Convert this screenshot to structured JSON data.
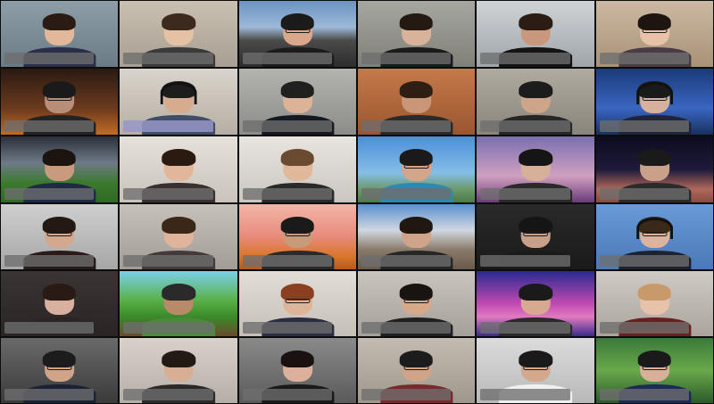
{
  "app": {
    "view": "gallery",
    "columns": 6,
    "rows": 6
  },
  "tiles": [
    {
      "row": 0,
      "col": 0,
      "bg": "linear-gradient(#8d9ea8,#6a7b85)",
      "skin": "#e2b79a",
      "hair": "#2a1c14",
      "shirt": "#2b2f4a",
      "glasses": false,
      "headset": false
    },
    {
      "row": 0,
      "col": 1,
      "bg": "linear-gradient(#c9c0b2,#a89f92)",
      "skin": "#e6c2a4",
      "hair": "#3b2a1d",
      "shirt": "#3a3a3a",
      "glasses": false,
      "headset": false
    },
    {
      "row": 0,
      "col": 2,
      "bg": "linear-gradient(#6b93c4 0%,#9db9d6 40%,#4a4a4a 60%,#2d2d2d 100%)",
      "skin": "#d9a88a",
      "hair": "#1b1b1b",
      "shirt": "#1c1c1c",
      "glasses": true,
      "headset": false
    },
    {
      "row": 0,
      "col": 3,
      "bg": "linear-gradient(#a7a7a2,#808078)",
      "skin": "#d8b39a",
      "hair": "#241a12",
      "shirt": "#1a1a1a",
      "glasses": false,
      "headset": false
    },
    {
      "row": 0,
      "col": 4,
      "bg": "linear-gradient(#cfd3d6,#9fa5aa)",
      "skin": "#c9987c",
      "hair": "#2b1d14",
      "shirt": "#141414",
      "glasses": false,
      "headset": false
    },
    {
      "row": 0,
      "col": 5,
      "bg": "linear-gradient(#cdb9a3,#a89278)",
      "skin": "#e8c2a8",
      "hair": "#1e1410",
      "shirt": "#4a3c44",
      "glasses": true,
      "headset": false
    },
    {
      "row": 1,
      "col": 0,
      "bg": "linear-gradient(#2a1a12,#6b3a1e 60%,#c56b22)",
      "skin": "#b98e78",
      "hair": "#1a1a1a",
      "shirt": "#232323",
      "glasses": true,
      "headset": false
    },
    {
      "row": 1,
      "col": 1,
      "bg": "linear-gradient(#d9d4cc,#b6aea2)",
      "skin": "#d6ab8e",
      "hair": "#1d1d1d",
      "shirt": "#3f4d66",
      "glasses": false,
      "headset": true,
      "highlight": true
    },
    {
      "row": 1,
      "col": 2,
      "bg": "linear-gradient(#b3b3b0,#8c8c88)",
      "skin": "#dcb396",
      "hair": "#202020",
      "shirt": "#151a22",
      "glasses": false,
      "headset": false
    },
    {
      "row": 1,
      "col": 3,
      "bg": "linear-gradient(#c67a4a,#9a5530)",
      "skin": "#c99678",
      "hair": "#2e1e14",
      "shirt": "#2a2a2a",
      "glasses": false,
      "headset": false
    },
    {
      "row": 1,
      "col": 4,
      "bg": "linear-gradient(#b0aaa0,#8a857c)",
      "skin": "#cfa58a",
      "hair": "#1c1c1c",
      "shirt": "#262626",
      "glasses": false,
      "headset": false
    },
    {
      "row": 1,
      "col": 5,
      "bg": "linear-gradient(#1b3a7a,#3a66c0 60%,#183060)",
      "skin": "#d8b0a0",
      "hair": "#1a1a1a",
      "shirt": "#20243a",
      "glasses": true,
      "headset": true
    },
    {
      "row": 2,
      "col": 0,
      "bg": "linear-gradient(#2b2f3a 0%,#6e7a88 40%,#3c7a2e 70%,#2f6a24 100%)",
      "skin": "#c99a7e",
      "hair": "#1c140f",
      "shirt": "#1f2a44",
      "glasses": false,
      "headset": false
    },
    {
      "row": 2,
      "col": 1,
      "bg": "linear-gradient(#e6e1da,#c9c3bb)",
      "skin": "#e2b69a",
      "hair": "#2a1a10",
      "shirt": "#3a3030",
      "glasses": false,
      "headset": false
    },
    {
      "row": 2,
      "col": 2,
      "bg": "linear-gradient(#e8e4df,#cbc6c0)",
      "skin": "#e0b89c",
      "hair": "#6a4a30",
      "shirt": "#2a2a2a",
      "glasses": false,
      "headset": false
    },
    {
      "row": 2,
      "col": 3,
      "bg": "linear-gradient(#4b8fd8 0%,#86bde8 55%,#6a9a6a 80%,#4a7a4a 100%)",
      "skin": "#d3a58a",
      "hair": "#1a1a1a",
      "shirt": "#2c8ab0",
      "glasses": true,
      "headset": false
    },
    {
      "row": 2,
      "col": 4,
      "bg": "linear-gradient(#7a6fb0,#d0a0c0 60%,#6a3a7a)",
      "skin": "#d7b09a",
      "hair": "#151515",
      "shirt": "#2a2a2a",
      "glasses": false,
      "headset": false
    },
    {
      "row": 2,
      "col": 5,
      "bg": "linear-gradient(#0c0c20 0%,#1e1a3a 50%,#b0685a 80%,#8a4a40 100%)",
      "skin": "#c9a08a",
      "hair": "#1a1a1a",
      "shirt": "#2b2b2b",
      "glasses": false,
      "headset": false
    },
    {
      "row": 3,
      "col": 0,
      "bg": "linear-gradient(#cfcfcf,#a6a6a6)",
      "skin": "#d4a88e",
      "hair": "#231812",
      "shirt": "#2a1a1a",
      "glasses": true,
      "headset": false
    },
    {
      "row": 3,
      "col": 1,
      "bg": "linear-gradient(#c6c1bb,#a29c95)",
      "skin": "#dfb49a",
      "hair": "#3b2718",
      "shirt": "#453a38",
      "glasses": false,
      "headset": false
    },
    {
      "row": 3,
      "col": 2,
      "bg": "linear-gradient(#f2b6a8 0%,#e88a7a 50%,#d9762a 80%,#b45a20 100%)",
      "skin": "#c99a7a",
      "hair": "#1a1a1a",
      "shirt": "#2a2a2a",
      "glasses": true,
      "headset": false
    },
    {
      "row": 3,
      "col": 3,
      "bg": "linear-gradient(#5a8fd0 0%,#d0d8e0 40%,#8a7a6a 70%,#6a5a4a 100%)",
      "skin": "#d0a48a",
      "hair": "#1f1710",
      "shirt": "#262626",
      "glasses": false,
      "headset": false
    },
    {
      "row": 3,
      "col": 4,
      "bg": "linear-gradient(#2a2a2a,#1a1a1a)",
      "skin": "#c8a08a",
      "hair": "#151515",
      "shirt": "#1a1a1a",
      "glasses": true,
      "headset": false
    },
    {
      "row": 3,
      "col": 5,
      "bg": "linear-gradient(#6a9ad8,#4a78b8)",
      "skin": "#dcb49e",
      "hair": "#3a2818",
      "shirt": "#1c2230",
      "glasses": true,
      "headset": true
    },
    {
      "row": 4,
      "col": 0,
      "bg": "linear-gradient(#3a3434,#2a2424)",
      "skin": "#d8b0a0",
      "hair": "#2a1a14",
      "shirt": "#2a2424",
      "glasses": false,
      "headset": false
    },
    {
      "row": 4,
      "col": 1,
      "bg": "linear-gradient(#7ad0e8 0%,#5ab048 45%,#3a8a2a 70%,#6a4a2a 100%)",
      "skin": "#b88a6a",
      "hair": "#2a2a2a",
      "shirt": "#4a8a3a",
      "glasses": false,
      "headset": false
    },
    {
      "row": 4,
      "col": 2,
      "bg": "linear-gradient(#e2ddd6,#c5bfb7)",
      "skin": "#e0b496",
      "hair": "#8a4020",
      "shirt": "#2a2e40",
      "glasses": true,
      "headset": false
    },
    {
      "row": 4,
      "col": 3,
      "bg": "linear-gradient(#c9c4bd,#a5a09a)",
      "skin": "#d6a88c",
      "hair": "#1a1410",
      "shirt": "#202020",
      "glasses": true,
      "headset": false
    },
    {
      "row": 4,
      "col": 4,
      "bg": "linear-gradient(#2a2a90 0%,#c04ab0 50%,#e07ac0 70%,#3a2a8a 100%)",
      "skin": "#d8a890",
      "hair": "#1a1a1a",
      "shirt": "#2a2a2a",
      "glasses": false,
      "headset": false
    },
    {
      "row": 4,
      "col": 5,
      "bg": "linear-gradient(#cfcac4,#aaa49c)",
      "skin": "#e6c2aa",
      "hair": "#c89a6a",
      "shirt": "#6a2020",
      "glasses": false,
      "headset": false
    },
    {
      "row": 5,
      "col": 0,
      "bg": "linear-gradient(#6a6a6a,#3a3a3a)",
      "skin": "#cfa488",
      "hair": "#1c1c1c",
      "shirt": "#1a2238",
      "glasses": true,
      "headset": false
    },
    {
      "row": 5,
      "col": 1,
      "bg": "linear-gradient(#d8d2ca,#b4aea6)",
      "skin": "#d8ae94",
      "hair": "#221a14",
      "shirt": "#2a2a2a",
      "glasses": false,
      "headset": false
    },
    {
      "row": 5,
      "col": 2,
      "bg": "linear-gradient(#8a8a8a,#5a5a5a)",
      "skin": "#dcb09a",
      "hair": "#1a1210",
      "shirt": "#1a1a1a",
      "glasses": false,
      "headset": false
    },
    {
      "row": 5,
      "col": 3,
      "bg": "linear-gradient(#c4bcb2,#a0978c)",
      "skin": "#d0a488",
      "hair": "#1c1c1c",
      "shirt": "#7a2a2a",
      "glasses": true,
      "headset": false
    },
    {
      "row": 5,
      "col": 4,
      "bg": "linear-gradient(#dcdcdc,#b8b8b8)",
      "skin": "#d4a88c",
      "hair": "#1a1a1a",
      "shirt": "#f0f0f0",
      "glasses": true,
      "headset": false
    },
    {
      "row": 5,
      "col": 5,
      "bg": "linear-gradient(#3a7a3a 0%,#6aa84a 50%,#2a5a2a 100%)",
      "skin": "#d8b09a",
      "hair": "#1a1a1a",
      "shirt": "#1c2a5a",
      "glasses": true,
      "headset": false
    }
  ]
}
